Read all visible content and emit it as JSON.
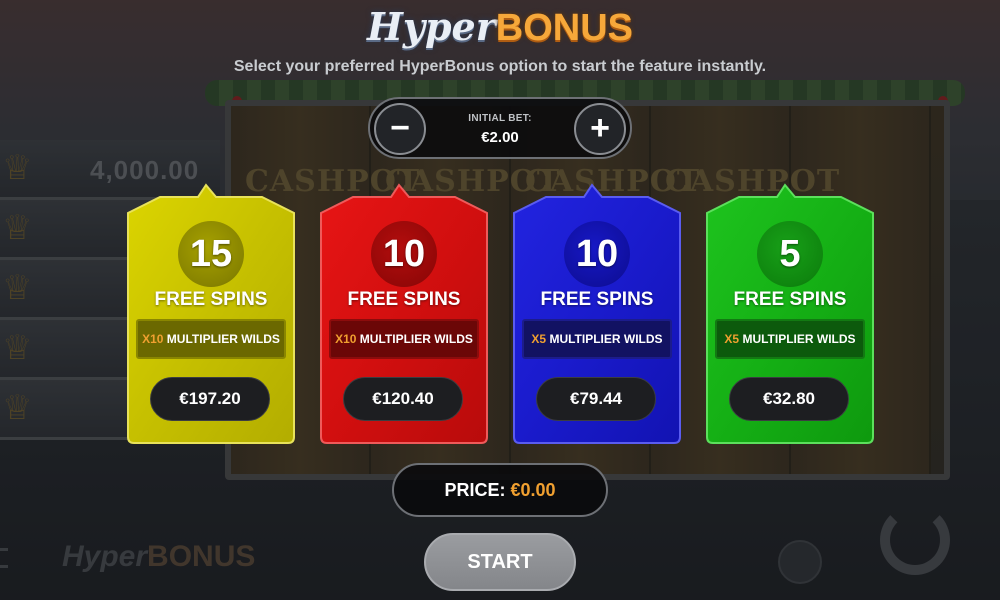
{
  "header": {
    "logo_hyper": "Hyper",
    "logo_bonus": "BONUS",
    "subtitle": "Select your preferred HyperBonus option to start the feature instantly."
  },
  "bet": {
    "minus_label": "−",
    "plus_label": "+",
    "label": "INITIAL BET:",
    "value": "€2.00"
  },
  "options": [
    {
      "color": "#c9c500",
      "spins": "15",
      "spins_label": "FREE SPINS",
      "multiplier": "X10",
      "multiplier_label": "MULTIPLIER WILDS",
      "price": "€197.20"
    },
    {
      "color": "#d81010",
      "spins": "10",
      "spins_label": "FREE SPINS",
      "multiplier": "X10",
      "multiplier_label": "MULTIPLIER WILDS",
      "price": "€120.40"
    },
    {
      "color": "#1a1bd0",
      "spins": "10",
      "spins_label": "FREE SPINS",
      "multiplier": "X5",
      "multiplier_label": "MULTIPLIER WILDS",
      "price": "€79.44"
    },
    {
      "color": "#14b014",
      "spins": "5",
      "spins_label": "FREE SPINS",
      "multiplier": "X5",
      "multiplier_label": "MULTIPLIER WILDS",
      "price": "€32.80"
    }
  ],
  "price": {
    "label": "PRICE:",
    "value": "€0.00"
  },
  "start_label": "START",
  "background": {
    "reel_label": "CASHPOT",
    "ladder_value": "4,000.00",
    "bottom_logo_hyper": "Hyper",
    "bottom_logo_bonus": "BONUS"
  }
}
